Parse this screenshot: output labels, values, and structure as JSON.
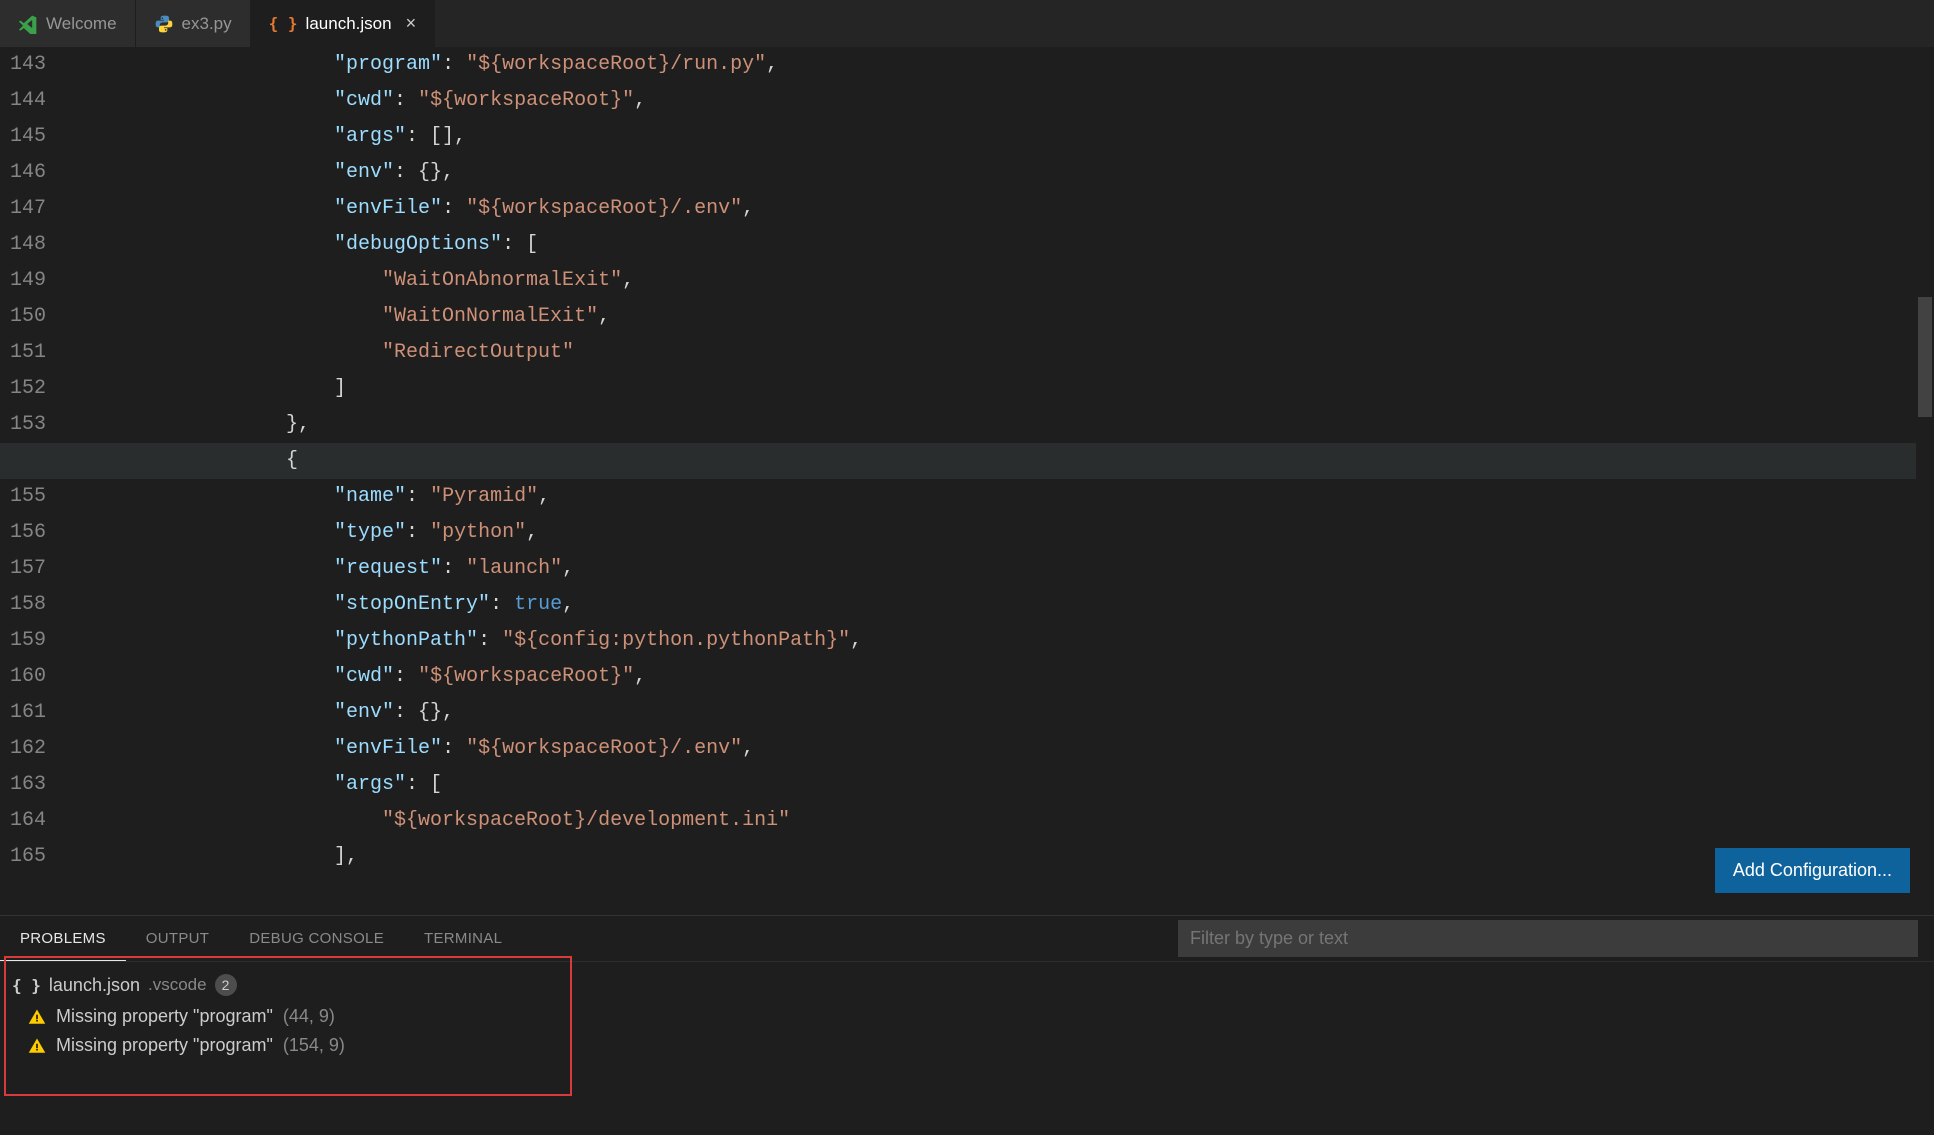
{
  "tabs": [
    {
      "label": "Welcome",
      "icon": "vscode-icon"
    },
    {
      "label": "ex3.py",
      "icon": "python-icon"
    },
    {
      "label": "launch.json",
      "icon": "json-icon",
      "active": true,
      "close": true
    }
  ],
  "line_start": 143,
  "code_lines": [
    {
      "indent": 12,
      "tokens": [
        [
          "key",
          "\"program\""
        ],
        [
          "punc",
          ": "
        ],
        [
          "str",
          "\"${workspaceRoot}/run.py\""
        ],
        [
          "punc",
          ","
        ]
      ]
    },
    {
      "indent": 12,
      "tokens": [
        [
          "key",
          "\"cwd\""
        ],
        [
          "punc",
          ": "
        ],
        [
          "str",
          "\"${workspaceRoot}\""
        ],
        [
          "punc",
          ","
        ]
      ]
    },
    {
      "indent": 12,
      "tokens": [
        [
          "key",
          "\"args\""
        ],
        [
          "punc",
          ": [],"
        ]
      ]
    },
    {
      "indent": 12,
      "tokens": [
        [
          "key",
          "\"env\""
        ],
        [
          "punc",
          ": {},"
        ]
      ]
    },
    {
      "indent": 12,
      "tokens": [
        [
          "key",
          "\"envFile\""
        ],
        [
          "punc",
          ": "
        ],
        [
          "str",
          "\"${workspaceRoot}/.env\""
        ],
        [
          "punc",
          ","
        ]
      ]
    },
    {
      "indent": 12,
      "tokens": [
        [
          "key",
          "\"debugOptions\""
        ],
        [
          "punc",
          ": ["
        ]
      ]
    },
    {
      "indent": 16,
      "tokens": [
        [
          "str",
          "\"WaitOnAbnormalExit\""
        ],
        [
          "punc",
          ","
        ]
      ]
    },
    {
      "indent": 16,
      "tokens": [
        [
          "str",
          "\"WaitOnNormalExit\""
        ],
        [
          "punc",
          ","
        ]
      ]
    },
    {
      "indent": 16,
      "tokens": [
        [
          "str",
          "\"RedirectOutput\""
        ]
      ]
    },
    {
      "indent": 12,
      "tokens": [
        [
          "punc",
          "]"
        ]
      ]
    },
    {
      "indent": 8,
      "tokens": [
        [
          "punc",
          "},"
        ]
      ]
    },
    {
      "indent": 8,
      "tokens": [
        [
          "punc",
          "{"
        ]
      ],
      "hl": true
    },
    {
      "indent": 12,
      "tokens": [
        [
          "key",
          "\"name\""
        ],
        [
          "punc",
          ": "
        ],
        [
          "str",
          "\"Pyramid\""
        ],
        [
          "punc",
          ","
        ]
      ]
    },
    {
      "indent": 12,
      "tokens": [
        [
          "key",
          "\"type\""
        ],
        [
          "punc",
          ": "
        ],
        [
          "str",
          "\"python\""
        ],
        [
          "punc",
          ","
        ]
      ]
    },
    {
      "indent": 12,
      "tokens": [
        [
          "key",
          "\"request\""
        ],
        [
          "punc",
          ": "
        ],
        [
          "str",
          "\"launch\""
        ],
        [
          "punc",
          ","
        ]
      ]
    },
    {
      "indent": 12,
      "tokens": [
        [
          "key",
          "\"stopOnEntry\""
        ],
        [
          "punc",
          ": "
        ],
        [
          "const",
          "true"
        ],
        [
          "punc",
          ","
        ]
      ]
    },
    {
      "indent": 12,
      "tokens": [
        [
          "key",
          "\"pythonPath\""
        ],
        [
          "punc",
          ": "
        ],
        [
          "str",
          "\"${config:python.pythonPath}\""
        ],
        [
          "punc",
          ","
        ]
      ]
    },
    {
      "indent": 12,
      "tokens": [
        [
          "key",
          "\"cwd\""
        ],
        [
          "punc",
          ": "
        ],
        [
          "str",
          "\"${workspaceRoot}\""
        ],
        [
          "punc",
          ","
        ]
      ]
    },
    {
      "indent": 12,
      "tokens": [
        [
          "key",
          "\"env\""
        ],
        [
          "punc",
          ": {},"
        ]
      ]
    },
    {
      "indent": 12,
      "tokens": [
        [
          "key",
          "\"envFile\""
        ],
        [
          "punc",
          ": "
        ],
        [
          "str",
          "\"${workspaceRoot}/.env\""
        ],
        [
          "punc",
          ","
        ]
      ]
    },
    {
      "indent": 12,
      "tokens": [
        [
          "key",
          "\"args\""
        ],
        [
          "punc",
          ": ["
        ]
      ]
    },
    {
      "indent": 16,
      "tokens": [
        [
          "str",
          "\"${workspaceRoot}/development.ini\""
        ]
      ]
    },
    {
      "indent": 12,
      "tokens": [
        [
          "punc",
          "],"
        ]
      ]
    }
  ],
  "add_config_label": "Add Configuration...",
  "panel": {
    "tabs": [
      "PROBLEMS",
      "OUTPUT",
      "DEBUG CONSOLE",
      "TERMINAL"
    ],
    "active_tab": 0,
    "filter_placeholder": "Filter by type or text",
    "file": {
      "name": "launch.json",
      "folder": ".vscode",
      "count": "2"
    },
    "items": [
      {
        "msg": "Missing property \"program\"",
        "loc": "(44, 9)"
      },
      {
        "msg": "Missing property \"program\"",
        "loc": "(154, 9)"
      }
    ]
  }
}
